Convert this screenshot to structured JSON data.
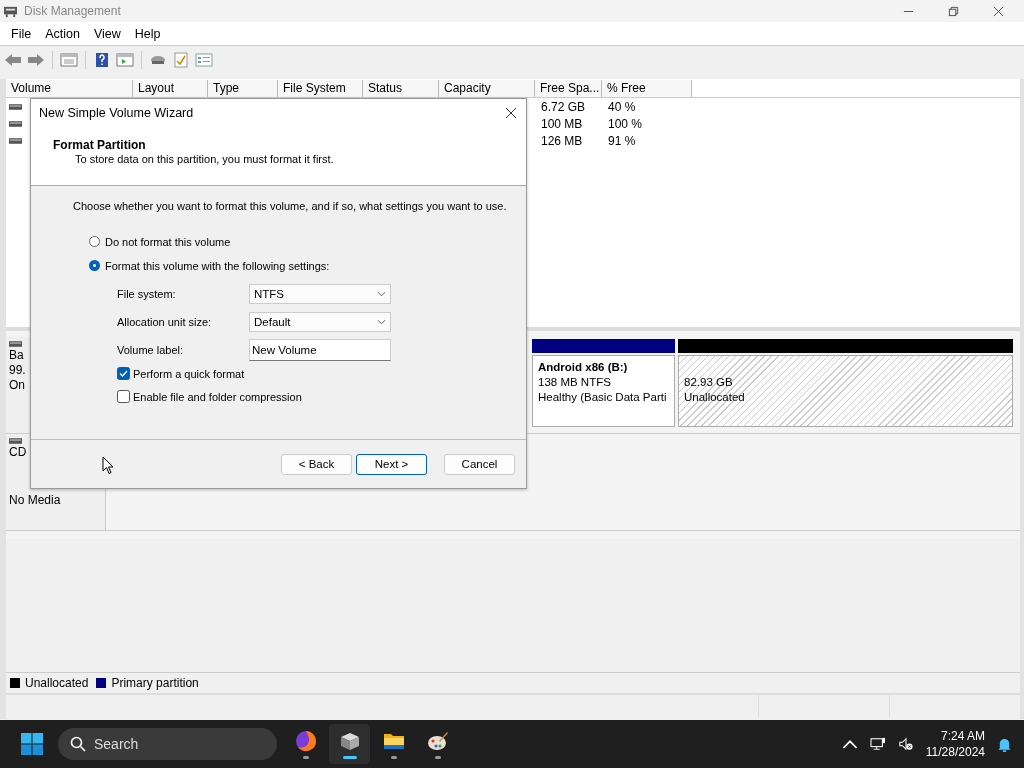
{
  "window": {
    "title": "Disk Management"
  },
  "menu": [
    "File",
    "Action",
    "View",
    "Help"
  ],
  "volumes": {
    "columns": [
      "Volume",
      "Layout",
      "Type",
      "File System",
      "Status",
      "Capacity",
      "Free Spa...",
      "% Free"
    ],
    "rows": [
      {
        "free_space": "6.72 GB",
        "percent_free": "40 %"
      },
      {
        "free_space": "100 MB",
        "percent_free": "100 %"
      },
      {
        "free_space": "126 MB",
        "percent_free": "91 %"
      }
    ]
  },
  "disks": [
    {
      "name": "Ba",
      "size": "99.",
      "status": "On",
      "partitions": [
        {
          "kind": "primary",
          "name": "Android x86  (B:)",
          "size": "138 MB NTFS",
          "status": "Healthy (Basic Data Parti"
        },
        {
          "kind": "unallocated",
          "size": "82.93 GB",
          "status": "Unallocated"
        }
      ]
    },
    {
      "name": "CD",
      "status": "No Media"
    }
  ],
  "legend": [
    {
      "label": "Unallocated",
      "color": "#000000"
    },
    {
      "label": "Primary partition",
      "color": "#000080"
    }
  ],
  "dialog": {
    "title": "New Simple Volume Wizard",
    "heading": "Format Partition",
    "subtitle": "To store data on this partition, you must format it first.",
    "instruction": "Choose whether you want to format this volume, and if so, what settings you want to use.",
    "radios": [
      {
        "label": "Do not format this volume",
        "selected": false
      },
      {
        "label": "Format this volume with the following settings:",
        "selected": true
      }
    ],
    "fields": [
      {
        "label": "File system:",
        "kind": "dropdown",
        "value": "NTFS"
      },
      {
        "label": "Allocation unit size:",
        "kind": "dropdown",
        "value": "Default"
      },
      {
        "label": "Volume label:",
        "kind": "text",
        "value": "New Volume"
      }
    ],
    "checkboxes": [
      {
        "label": "Perform a quick format",
        "checked": true
      },
      {
        "label": "Enable file and folder compression",
        "checked": false
      }
    ],
    "buttons": [
      {
        "label": "< Back",
        "default": false
      },
      {
        "label": "Next >",
        "default": true
      },
      {
        "label": "Cancel",
        "default": false
      }
    ]
  },
  "taskbar": {
    "search": {
      "placeholder": "Search"
    },
    "apps": [
      {
        "kind": "browser",
        "selected": false
      },
      {
        "kind": "disk",
        "selected": true
      },
      {
        "kind": "folder",
        "selected": false
      },
      {
        "kind": "paint",
        "selected": false
      }
    ],
    "time": "7:24 AM",
    "date": "11/28/2024"
  }
}
